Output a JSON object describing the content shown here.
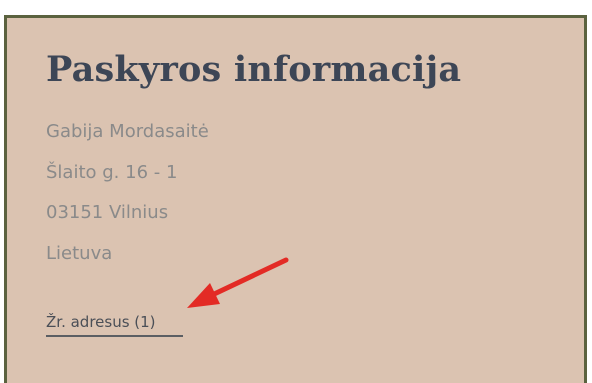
{
  "account": {
    "title": "Paskyros informacija",
    "name": "Gabija Mordasaitė",
    "street": "Šlaito g. 16 - 1",
    "city": "03151 Vilnius",
    "country": "Lietuva",
    "view_addresses_link": "Žr. adresus (1)"
  },
  "colors": {
    "panel_bg": "#dbc3b1",
    "border": "#5b623f",
    "title": "#3d4656",
    "text": "#8a8a8a",
    "arrow": "#e32b25"
  },
  "annotation": {
    "icon": "red-arrow-icon"
  }
}
